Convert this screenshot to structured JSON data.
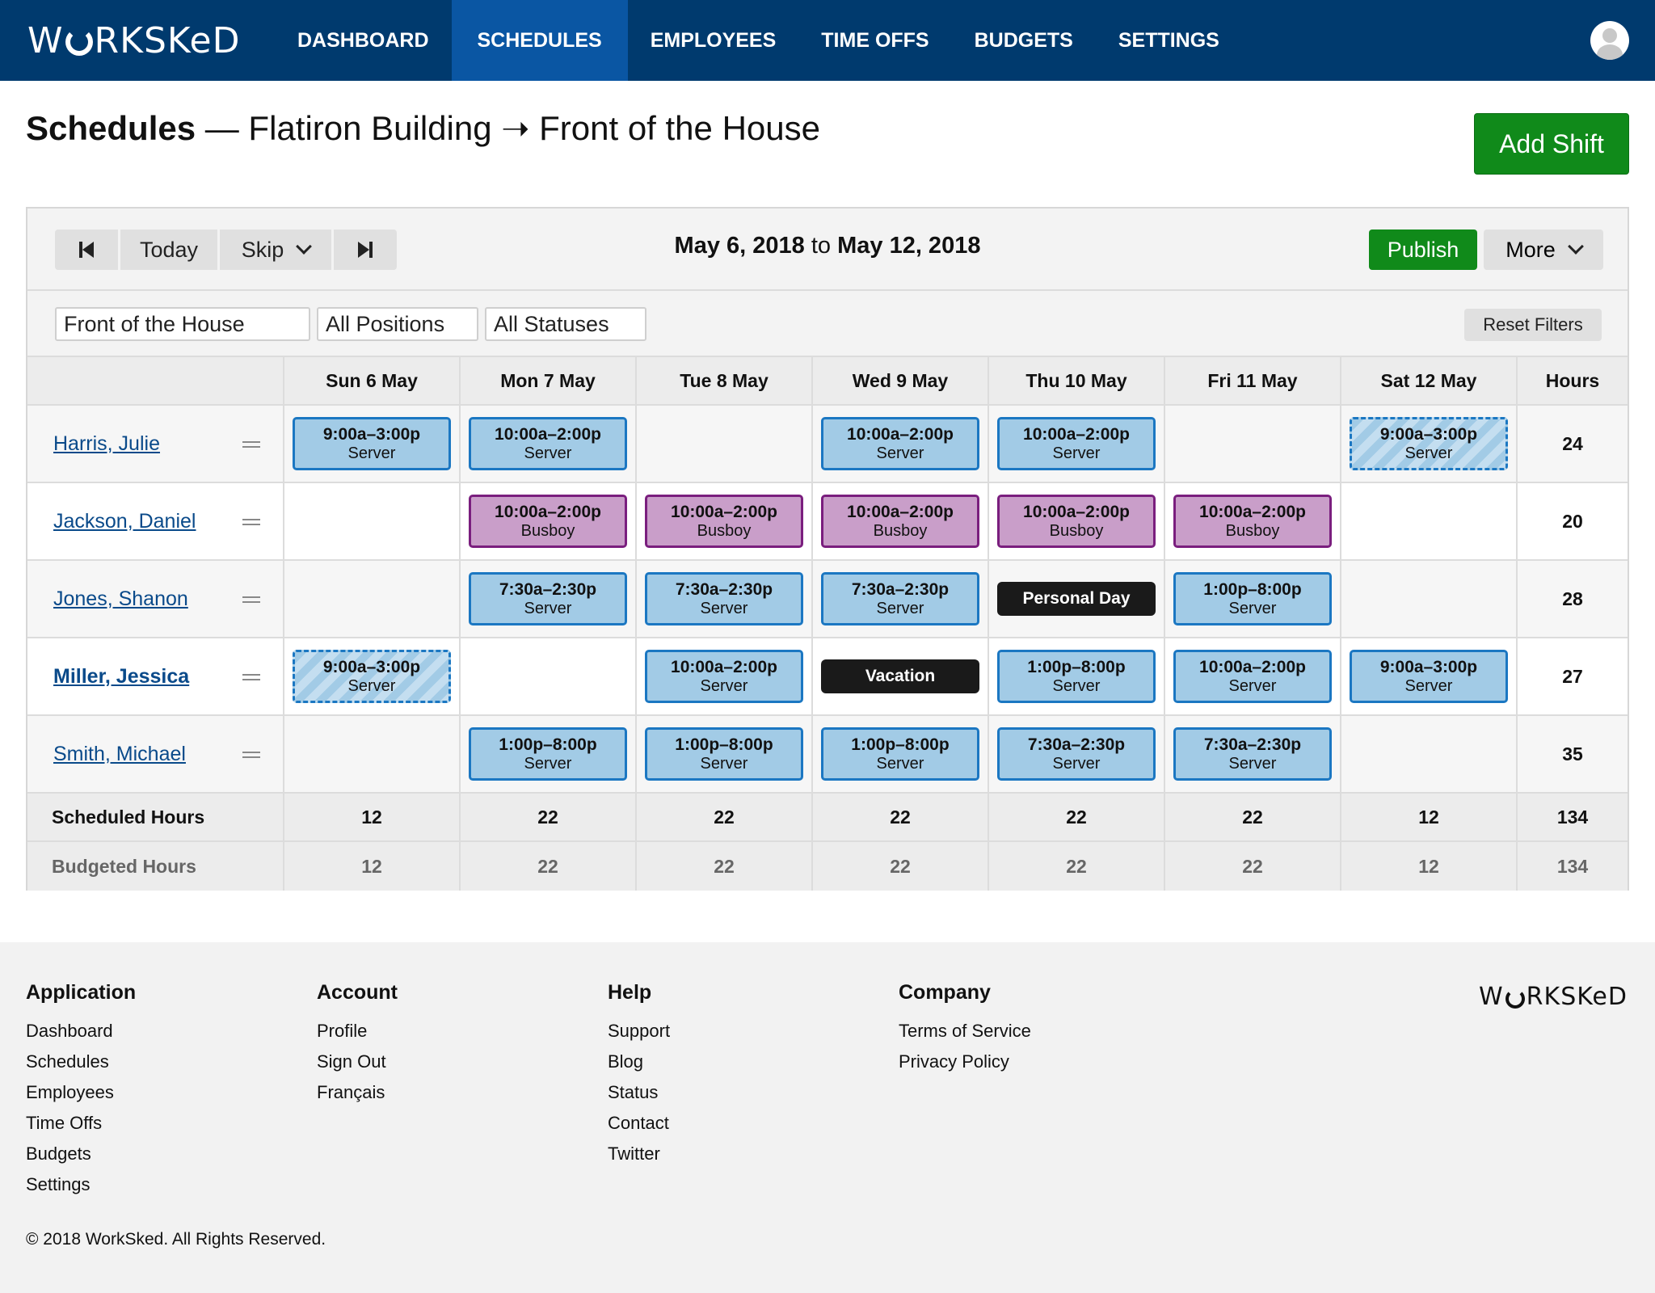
{
  "nav": {
    "logo_left": "W",
    "logo_right": "RKSKeD",
    "items": [
      {
        "label": "DASHBOARD"
      },
      {
        "label": "SCHEDULES",
        "active": true
      },
      {
        "label": "EMPLOYEES"
      },
      {
        "label": "TIME OFFS"
      },
      {
        "label": "BUDGETS"
      },
      {
        "label": "SETTINGS"
      }
    ],
    "avatar_icon": "user-avatar-icon"
  },
  "page": {
    "title_bold": "Schedules",
    "title_rest": " — Flatiron Building ➝ Front of the House",
    "add_shift_label": "Add Shift"
  },
  "toolbar": {
    "today_label": "Today",
    "skip_label": "Skip",
    "range_start": "May 6, 2018",
    "range_to": "to",
    "range_end": "May 12, 2018",
    "publish_label": "Publish",
    "more_label": "More"
  },
  "filters": {
    "location": "Front of the House",
    "positions": "All Positions",
    "statuses": "All Statuses",
    "reset_label": "Reset Filters"
  },
  "grid": {
    "days": [
      "Sun 6 May",
      "Mon 7 May",
      "Tue 8 May",
      "Wed 9 May",
      "Thu 10 May",
      "Fri 11 May",
      "Sat 12 May"
    ],
    "hours_header": "Hours",
    "employees": [
      {
        "name": "Harris, Julie",
        "hours": "24",
        "shifts": [
          {
            "time": "9:00a–3:00p",
            "position": "Server",
            "kind": "server"
          },
          {
            "time": "10:00a–2:00p",
            "position": "Server",
            "kind": "server"
          },
          null,
          {
            "time": "10:00a–2:00p",
            "position": "Server",
            "kind": "server"
          },
          {
            "time": "10:00a–2:00p",
            "position": "Server",
            "kind": "server"
          },
          null,
          {
            "time": "9:00a–3:00p",
            "position": "Server",
            "kind": "server",
            "draft": true
          }
        ]
      },
      {
        "name": "Jackson, Daniel",
        "hours": "20",
        "shifts": [
          null,
          {
            "time": "10:00a–2:00p",
            "position": "Busboy",
            "kind": "busboy"
          },
          {
            "time": "10:00a–2:00p",
            "position": "Busboy",
            "kind": "busboy"
          },
          {
            "time": "10:00a–2:00p",
            "position": "Busboy",
            "kind": "busboy"
          },
          {
            "time": "10:00a–2:00p",
            "position": "Busboy",
            "kind": "busboy"
          },
          {
            "time": "10:00a–2:00p",
            "position": "Busboy",
            "kind": "busboy"
          },
          null
        ]
      },
      {
        "name": "Jones, Shanon",
        "hours": "28",
        "shifts": [
          null,
          {
            "time": "7:30a–2:30p",
            "position": "Server",
            "kind": "server"
          },
          {
            "time": "7:30a–2:30p",
            "position": "Server",
            "kind": "server"
          },
          {
            "time": "7:30a–2:30p",
            "position": "Server",
            "kind": "server"
          },
          {
            "timeoff": "Personal Day"
          },
          {
            "time": "1:00p–8:00p",
            "position": "Server",
            "kind": "server"
          },
          null
        ]
      },
      {
        "name": "Miller, Jessica",
        "bold": true,
        "hours": "27",
        "shifts": [
          {
            "time": "9:00a–3:00p",
            "position": "Server",
            "kind": "server",
            "draft": true
          },
          null,
          {
            "time": "10:00a–2:00p",
            "position": "Server",
            "kind": "server"
          },
          {
            "timeoff": "Vacation"
          },
          {
            "time": "1:00p–8:00p",
            "position": "Server",
            "kind": "server"
          },
          {
            "time": "10:00a–2:00p",
            "position": "Server",
            "kind": "server"
          },
          {
            "time": "9:00a–3:00p",
            "position": "Server",
            "kind": "server"
          }
        ]
      },
      {
        "name": "Smith, Michael",
        "hours": "35",
        "shifts": [
          null,
          {
            "time": "1:00p–8:00p",
            "position": "Server",
            "kind": "server"
          },
          {
            "time": "1:00p–8:00p",
            "position": "Server",
            "kind": "server"
          },
          {
            "time": "1:00p–8:00p",
            "position": "Server",
            "kind": "server"
          },
          {
            "time": "7:30a–2:30p",
            "position": "Server",
            "kind": "server"
          },
          {
            "time": "7:30a–2:30p",
            "position": "Server",
            "kind": "server"
          },
          null
        ]
      }
    ],
    "scheduled": {
      "label": "Scheduled Hours",
      "values": [
        "12",
        "22",
        "22",
        "22",
        "22",
        "22",
        "12"
      ],
      "total": "134"
    },
    "budgeted": {
      "label": "Budgeted Hours",
      "values": [
        "12",
        "22",
        "22",
        "22",
        "22",
        "22",
        "12"
      ],
      "total": "134"
    }
  },
  "colors": {
    "nav_bg": "#003a6e",
    "nav_active": "#0a56a3",
    "primary_green": "#108a1a",
    "server_fill": "#a2cbe6",
    "server_border": "#1b77c2",
    "busboy_fill": "#c99ec9",
    "busboy_border": "#7a1e7e"
  },
  "footer": {
    "columns": [
      {
        "title": "Application",
        "links": [
          "Dashboard",
          "Schedules",
          "Employees",
          "Time Offs",
          "Budgets",
          "Settings"
        ]
      },
      {
        "title": "Account",
        "links": [
          "Profile",
          "Sign Out",
          "Français"
        ]
      },
      {
        "title": "Help",
        "links": [
          "Support",
          "Blog",
          "Status",
          "Contact",
          "Twitter"
        ]
      },
      {
        "title": "Company",
        "links": [
          "Terms of Service",
          "Privacy Policy"
        ]
      }
    ],
    "logo_left": "W",
    "logo_right": "RKSKeD",
    "copyright": "© 2018 WorkSked. All Rights Reserved."
  }
}
